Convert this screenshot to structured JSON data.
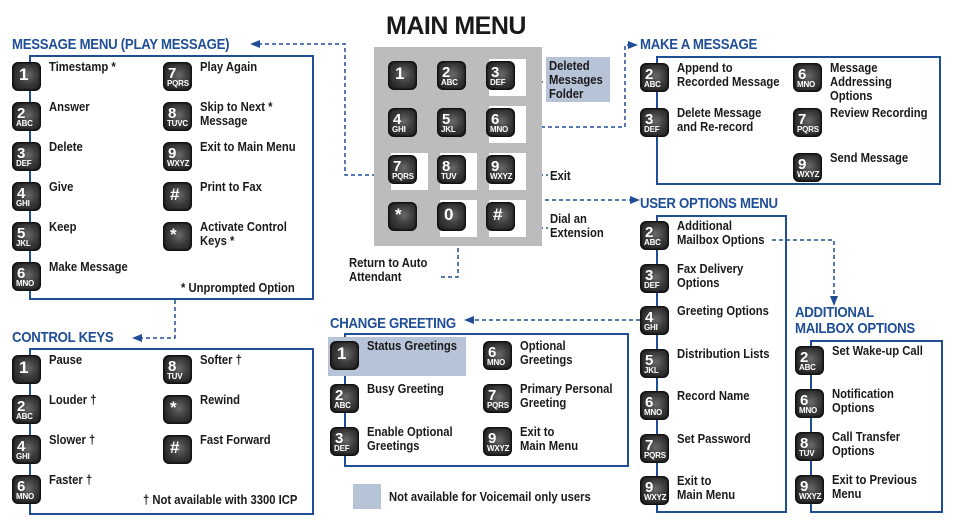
{
  "main_menu": {
    "title": "MAIN MENU",
    "keys": [
      {
        "digit": "1",
        "letters": ""
      },
      {
        "digit": "2",
        "letters": "ABC"
      },
      {
        "digit": "3",
        "letters": "DEF"
      },
      {
        "digit": "4",
        "letters": "GHI"
      },
      {
        "digit": "5",
        "letters": "JKL"
      },
      {
        "digit": "6",
        "letters": "MNO"
      },
      {
        "digit": "7",
        "letters": "PQRS"
      },
      {
        "digit": "8",
        "letters": "TUV"
      },
      {
        "digit": "9",
        "letters": "WXYZ"
      },
      {
        "digit": "*",
        "letters": ""
      },
      {
        "digit": "0",
        "letters": ""
      },
      {
        "digit": "#",
        "letters": ""
      }
    ],
    "deleted_folder": "Deleted Messages Folder",
    "exit": "Exit",
    "dial_extension": "Dial an Extension",
    "return_auto": "Return to Auto Attendant"
  },
  "message_menu": {
    "title": "MESSAGE MENU (PLAY MESSAGE)",
    "items": [
      {
        "digit": "1",
        "letters": "",
        "label": "Timestamp *"
      },
      {
        "digit": "2",
        "letters": "ABC",
        "label": "Answer"
      },
      {
        "digit": "3",
        "letters": "DEF",
        "label": "Delete"
      },
      {
        "digit": "4",
        "letters": "GHI",
        "label": "Give"
      },
      {
        "digit": "5",
        "letters": "JKL",
        "label": "Keep"
      },
      {
        "digit": "6",
        "letters": "MNO",
        "label": "Make Message"
      },
      {
        "digit": "7",
        "letters": "PQRS",
        "label": "Play Again"
      },
      {
        "digit": "8",
        "letters": "TUVC",
        "label": "Skip to Next *\nMessage"
      },
      {
        "digit": "9",
        "letters": "WXYZ",
        "label": "Exit to Main Menu"
      },
      {
        "digit": "#",
        "letters": "",
        "label": "Print to Fax"
      },
      {
        "digit": "*",
        "letters": "",
        "label": "Activate Control\nKeys *"
      }
    ],
    "note": "* Unprompted Option"
  },
  "control_keys": {
    "title": "CONTROL KEYS",
    "items": [
      {
        "digit": "1",
        "letters": "",
        "label": "Pause"
      },
      {
        "digit": "2",
        "letters": "ABC",
        "label": "Louder †"
      },
      {
        "digit": "4",
        "letters": "GHI",
        "label": "Slower †"
      },
      {
        "digit": "6",
        "letters": "MNO",
        "label": "Faster †"
      },
      {
        "digit": "8",
        "letters": "TUV",
        "label": "Softer †"
      },
      {
        "digit": "*",
        "letters": "",
        "label": "Rewind"
      },
      {
        "digit": "#",
        "letters": "",
        "label": "Fast Forward"
      }
    ],
    "note": "† Not available with 3300 ICP"
  },
  "change_greeting": {
    "title": "CHANGE GREETING",
    "items": [
      {
        "digit": "1",
        "letters": "",
        "label": "Status Greetings"
      },
      {
        "digit": "2",
        "letters": "ABC",
        "label": "Busy Greeting"
      },
      {
        "digit": "3",
        "letters": "DEF",
        "label": "Enable Optional\nGreetings"
      },
      {
        "digit": "6",
        "letters": "MNO",
        "label": "Optional\nGreetings"
      },
      {
        "digit": "7",
        "letters": "PQRS",
        "label": "Primary Personal\nGreeting"
      },
      {
        "digit": "9",
        "letters": "WXYZ",
        "label": "Exit to\nMain Menu"
      }
    ]
  },
  "legend": {
    "label": "Not available for Voicemail only users",
    "color": "#b7c3d7"
  },
  "make_message": {
    "title": "MAKE A MESSAGE",
    "items": [
      {
        "digit": "2",
        "letters": "ABC",
        "label": "Append to\nRecorded Message"
      },
      {
        "digit": "3",
        "letters": "DEF",
        "label": "Delete Message\nand Re-record"
      },
      {
        "digit": "6",
        "letters": "MNO",
        "label": "Message\nAddressing\nOptions"
      },
      {
        "digit": "7",
        "letters": "PQRS",
        "label": "Review Recording"
      },
      {
        "digit": "9",
        "letters": "WXYZ",
        "label": "Send Message"
      }
    ]
  },
  "user_options": {
    "title": "USER OPTIONS MENU",
    "items": [
      {
        "digit": "2",
        "letters": "ABC",
        "label": "Additional\nMailbox Options"
      },
      {
        "digit": "3",
        "letters": "DEF",
        "label": "Fax Delivery\nOptions"
      },
      {
        "digit": "4",
        "letters": "GHI",
        "label": "Greeting Options"
      },
      {
        "digit": "5",
        "letters": "JKL",
        "label": "Distribution Lists"
      },
      {
        "digit": "6",
        "letters": "MNO",
        "label": "Record Name"
      },
      {
        "digit": "7",
        "letters": "PQRS",
        "label": "Set Password"
      },
      {
        "digit": "9",
        "letters": "WXYZ",
        "label": "Exit to\nMain Menu"
      }
    ]
  },
  "additional_mailbox": {
    "title": "ADDITIONAL\nMAILBOX OPTIONS",
    "items": [
      {
        "digit": "2",
        "letters": "ABC",
        "label": "Set Wake-up Call"
      },
      {
        "digit": "6",
        "letters": "MNO",
        "label": "Notification\nOptions"
      },
      {
        "digit": "8",
        "letters": "TUV",
        "label": "Call Transfer\nOptions"
      },
      {
        "digit": "9",
        "letters": "WXYZ",
        "label": "Exit to Previous\nMenu"
      }
    ]
  },
  "colors": {
    "accent": "#1f4e96",
    "keypad_bg": "#bcbcbc",
    "highlight": "#b7c3d7"
  }
}
